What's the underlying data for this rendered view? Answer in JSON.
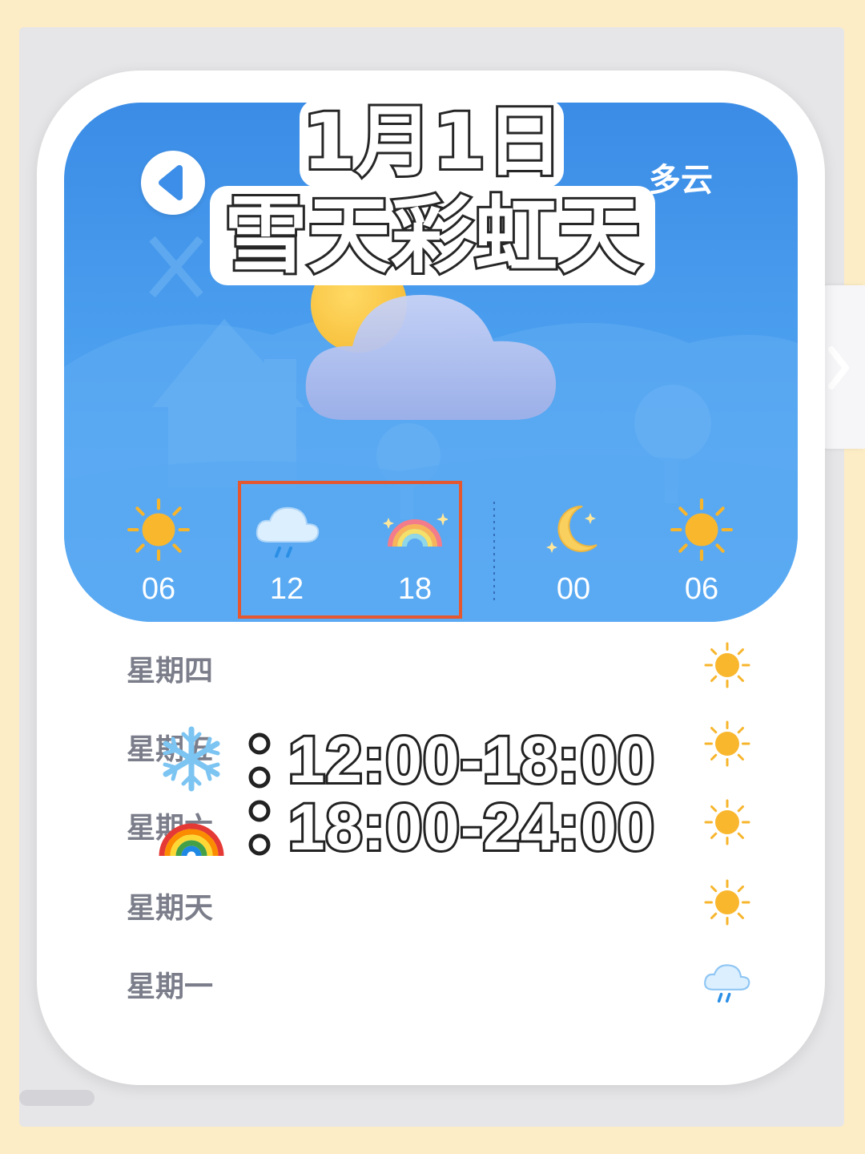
{
  "header": {
    "title_line1": "1月1日",
    "title_line2": "雪天彩虹天",
    "condition": "多云"
  },
  "hourly": [
    {
      "time": "06",
      "icon": "sun-icon"
    },
    {
      "time": "12",
      "icon": "rain-cloud-icon"
    },
    {
      "time": "18",
      "icon": "rainbow-icon"
    },
    {
      "time": "00",
      "icon": "moon-icon"
    },
    {
      "time": "06",
      "icon": "sun-icon"
    }
  ],
  "highlighted_hours": [
    "12",
    "18"
  ],
  "days": [
    {
      "name": "星期四",
      "icon": "sun-icon"
    },
    {
      "name": "星期五",
      "icon": "sun-icon"
    },
    {
      "name": "星期六",
      "icon": "sun-icon"
    },
    {
      "name": "星期天",
      "icon": "sun-icon"
    },
    {
      "name": "星期一",
      "icon": "rain-cloud-icon"
    }
  ],
  "overlay": {
    "snow": {
      "icon": "snowflake-icon",
      "time": "12:00-18:00"
    },
    "rainbow": {
      "icon": "rainbow-icon",
      "time": "18:00-24:00"
    }
  },
  "colors": {
    "page_background": "#FDEDC6",
    "panel_blue": "#4EA2F0",
    "highlight_border": "#E5572E",
    "sun": "#F7B52C"
  }
}
